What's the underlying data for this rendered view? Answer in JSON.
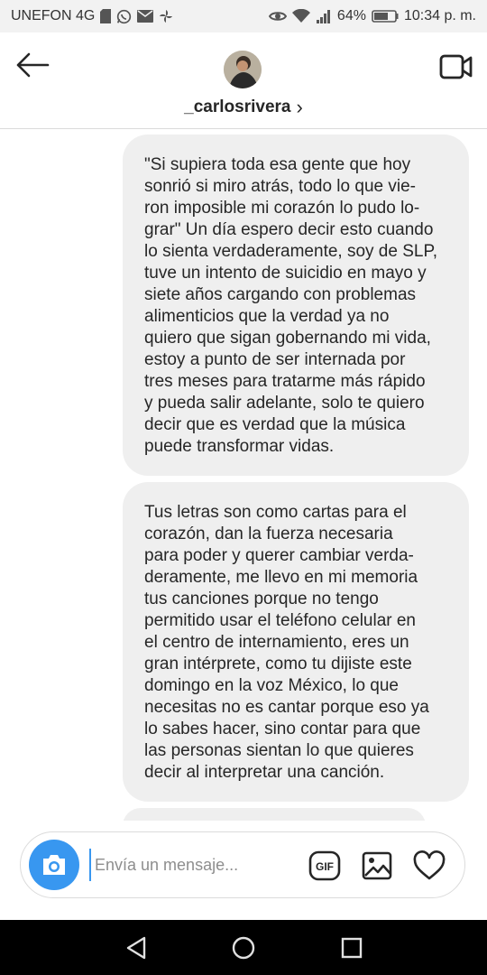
{
  "status_bar": {
    "carrier": "UNEFON 4G",
    "battery": "64%",
    "time": "10:34 p. m."
  },
  "header": {
    "username": "_carlosrivera",
    "chevron": "›",
    "icons": {
      "back": "arrow-left-icon",
      "video": "video-camera-icon",
      "avatar": "avatar"
    }
  },
  "messages": [
    {
      "text": "\"Si supiera toda esa gente que hoy\nsonrió si miro atrás, todo lo que vie-\nron imposible mi corazón lo pudo lo-\ngrar\" Un día espero decir esto cuando\nlo sienta verdaderamente, soy de SLP,\ntuve un intento de suicidio en mayo y\nsiete años cargando con problemas\nalimenticios que la verdad ya no\nquiero que sigan gobernando mi vida,\nestoy a punto de ser internada por\ntres meses para tratarme más rápido\ny pueda salir adelante, solo te quiero\ndecir que es verdad que la música\npuede transformar vidas."
    },
    {
      "text": "Tus letras son como cartas para el\ncorazón, dan la fuerza necesaria\npara poder y querer cambiar verda-\nderamente, me llevo en mi memoria\ntus canciones porque no tengo\npermitido usar el teléfono celular en\nel centro de internamiento, eres un\ngran intérprete, como tu dijiste este\ndomingo en la voz México, lo que\nnecesitas no es cantar porque eso ya\nlo sabes hacer, sino contar para que\nlas personas sientan lo que quieres\ndecir al interpretar una canción."
    },
    {
      "text": ""
    }
  ],
  "composer": {
    "placeholder": "Envía un mensaje...",
    "value": "",
    "gif_label": "GIF",
    "icons": [
      "camera-icon",
      "gif-icon",
      "image-icon",
      "heart-icon"
    ]
  },
  "nav_bar": {
    "icons": [
      "back-triangle-icon",
      "home-circle-icon",
      "recents-square-icon"
    ]
  },
  "colors": {
    "accent": "#3897f0",
    "bubble": "#efefef",
    "text": "#262626"
  }
}
